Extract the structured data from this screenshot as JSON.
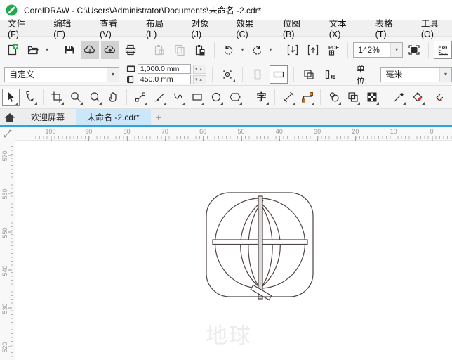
{
  "window": {
    "title": "CorelDRAW - C:\\Users\\Administrator\\Documents\\未命名 -2.cdr*"
  },
  "menu_bar": {
    "items": [
      "文件(F)",
      "编辑(E)",
      "查看(V)",
      "布局(L)",
      "对象(J)",
      "效果(C)",
      "位图(B)",
      "文本(X)",
      "表格(T)",
      "工具(O)"
    ]
  },
  "standard_toolbar": {
    "zoom_level": "142%",
    "icons": [
      "new-document-icon",
      "open-folder-icon",
      "save-icon",
      "cloud-download-icon",
      "cloud-upload-icon",
      "print-icon",
      "paste-special-icon",
      "copy-icon",
      "paste-icon",
      "undo-icon",
      "redo-icon",
      "import-icon",
      "export-icon",
      "pdf-export-icon",
      "fullscreen-preview-icon",
      "ruler-toggle-icon"
    ]
  },
  "property_bar": {
    "page_preset": "自定义",
    "page_width": "1,000.0 mm",
    "page_height": "450.0 mm",
    "units_label": "单位:",
    "units": "毫米",
    "icons": [
      "page-width-icon",
      "page-height-icon",
      "fit-page-icon",
      "portrait-icon",
      "landscape-icon",
      "all-pages-icon",
      "current-page-icon"
    ]
  },
  "toolbox": {
    "text_tool_label": "字",
    "icons": [
      "pick-tool-icon",
      "shape-tool-icon",
      "crop-tool-icon",
      "zoom-tool-icon",
      "zoom-out-tool-icon",
      "pan-tool-icon",
      "freehand-tool-icon",
      "artistic-media-tool-icon",
      "pen-tool-icon",
      "rectangle-tool-icon",
      "ellipse-tool-icon",
      "polygon-tool-icon",
      "text-tool-icon",
      "dimension-tool-icon",
      "connector-tool-icon",
      "effect-tool-icon",
      "transparency-tool-icon",
      "pattern-fill-icon",
      "eyedropper-tool-icon",
      "interactive-fill-tool-icon",
      "smart-fill-tool-icon"
    ]
  },
  "document_tabs": {
    "welcome_tab": "欢迎屏幕",
    "active_tab": "未命名 -2.cdr*",
    "new_tab_button": "+"
  },
  "rulers": {
    "horizontal_labels": [
      "100",
      "90",
      "80",
      "70",
      "60",
      "50",
      "40",
      "30",
      "20",
      "10",
      "0"
    ],
    "vertical_labels": [
      "570",
      "560",
      "550",
      "540",
      "530",
      "520"
    ]
  },
  "canvas": {
    "artwork_label": "地球"
  },
  "colors": {
    "accent_blue": "#30a2e0",
    "active_tab_bg": "#cce7fa",
    "logo_green": "#21a94e",
    "drawing_stroke": "#4d4444",
    "connector_orange": "#e87d1e",
    "fill_red": "#d8372a",
    "artwork_label_color": "#ececec"
  }
}
